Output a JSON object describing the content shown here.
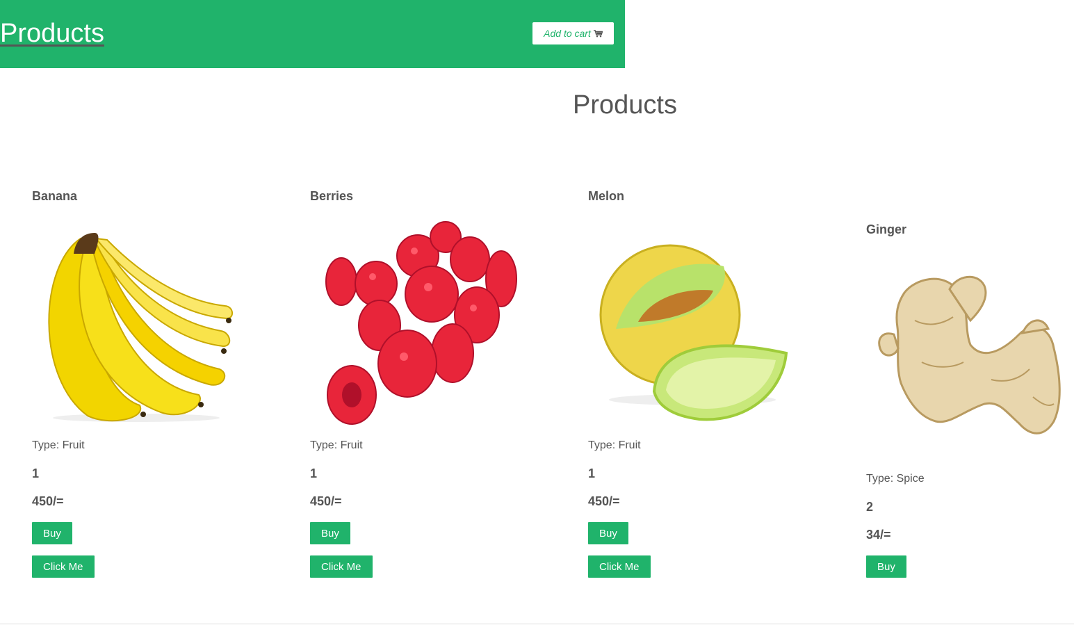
{
  "header": {
    "brand": "Products",
    "cart_label": "Add to cart",
    "cart_icon": "shopping-cart-icon"
  },
  "main": {
    "title": "Products"
  },
  "colors": {
    "accent": "#20b36b",
    "text": "#555555"
  },
  "products": [
    {
      "name": "Banana",
      "type": "Type: Fruit",
      "quantity": "1",
      "price": "450/=",
      "buy_label": "Buy",
      "click_label": "Click Me",
      "image": "banana-image"
    },
    {
      "name": "Berries",
      "type": "Type: Fruit",
      "quantity": "1",
      "price": "450/=",
      "buy_label": "Buy",
      "click_label": "Click Me",
      "image": "raspberries-image"
    },
    {
      "name": "Melon",
      "type": "Type: Fruit",
      "quantity": "1",
      "price": "450/=",
      "buy_label": "Buy",
      "click_label": "Click Me",
      "image": "melon-image"
    },
    {
      "name": "Ginger",
      "type": "Type: Spice",
      "quantity": "2",
      "price": "34/=",
      "buy_label": "Buy",
      "image": "ginger-image"
    }
  ]
}
